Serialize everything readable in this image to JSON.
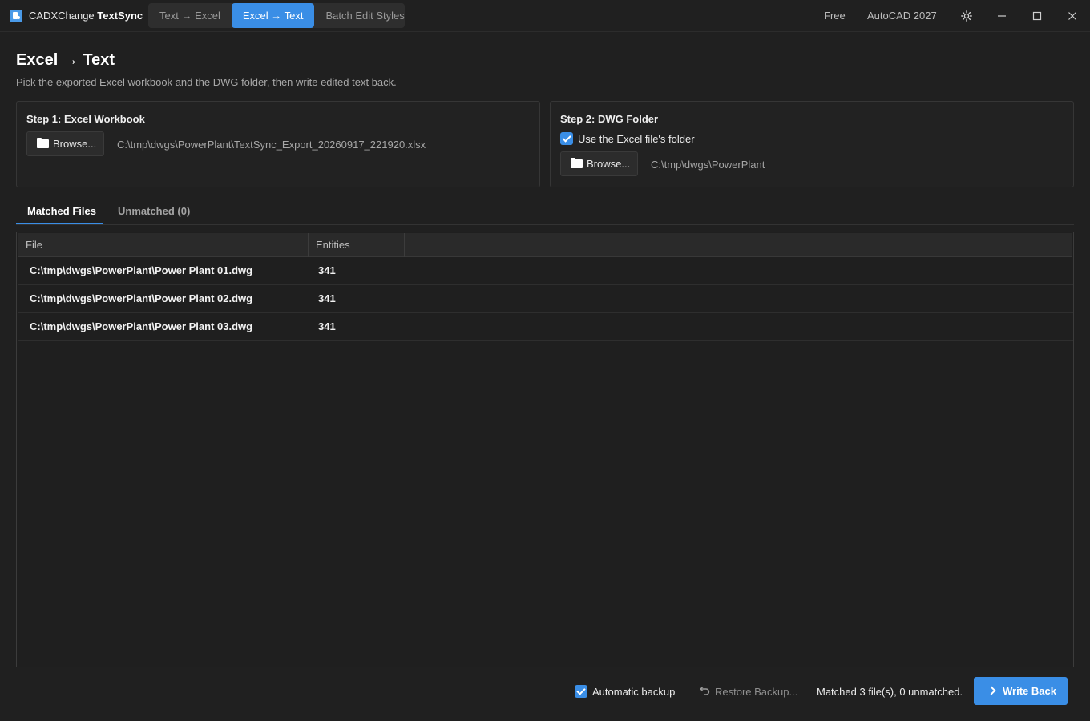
{
  "titlebar": {
    "app_name_prefix": "CADXChange",
    "app_name_bold": "TextSync",
    "mode_tabs": [
      {
        "label": "Text → Excel",
        "active": false
      },
      {
        "label": "Excel → Text",
        "active": true
      },
      {
        "label": "Batch Edit Styles",
        "active": false
      }
    ],
    "license": "Free",
    "host_app": "AutoCAD 2027",
    "theme_icon": "sun-icon",
    "window_controls": [
      "minimize-icon",
      "maximize-icon",
      "close-icon"
    ]
  },
  "header": {
    "title": "Excel → Text",
    "subtitle": "Pick the exported Excel workbook and the DWG folder, then write edited text back."
  },
  "step1": {
    "title": "Step 1: Excel Workbook",
    "browse_label": "Browse...",
    "path": "C:\\tmp\\dwgs\\PowerPlant\\TextSync_Export_20260917_221920.xlsx"
  },
  "step2": {
    "title": "Step 2: DWG Folder",
    "use_excel_folder_label": "Use the Excel file's folder",
    "use_excel_folder_checked": true,
    "browse_label": "Browse...",
    "path": "C:\\tmp\\dwgs\\PowerPlant"
  },
  "result_tabs": [
    {
      "label": "Matched Files",
      "active": true
    },
    {
      "label": "Unmatched (0)",
      "active": false
    }
  ],
  "table": {
    "columns": [
      "File",
      "Entities"
    ],
    "rows": [
      {
        "file": "C:\\tmp\\dwgs\\PowerPlant\\Power Plant 01.dwg",
        "entities": "341"
      },
      {
        "file": "C:\\tmp\\dwgs\\PowerPlant\\Power Plant 02.dwg",
        "entities": "341"
      },
      {
        "file": "C:\\tmp\\dwgs\\PowerPlant\\Power Plant 03.dwg",
        "entities": "341"
      }
    ]
  },
  "footer": {
    "auto_backup_label": "Automatic backup",
    "auto_backup_checked": true,
    "restore_label": "Restore Backup...",
    "status": "Matched 3 file(s), 0 unmatched.",
    "write_back_label": "Write Back"
  },
  "colors": {
    "accent": "#3a8ee6",
    "background": "#202020",
    "panel_border": "#363636"
  }
}
